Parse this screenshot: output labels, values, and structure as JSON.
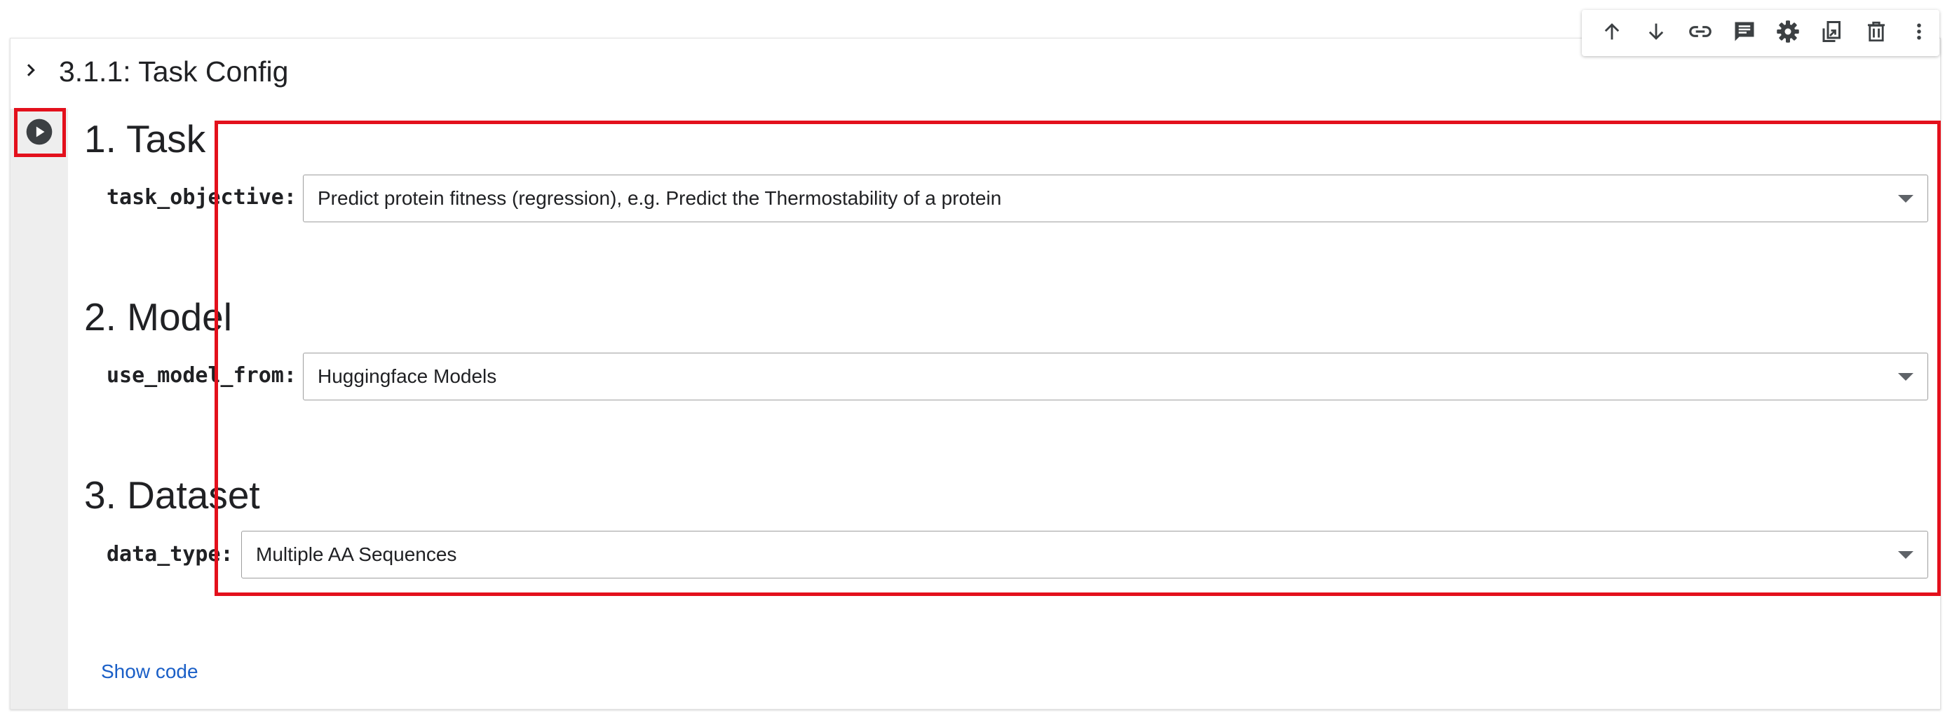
{
  "toolbar": {
    "buttons": [
      {
        "name": "move-cell-up-icon",
        "label": "Move cell up"
      },
      {
        "name": "move-cell-down-icon",
        "label": "Move cell down"
      },
      {
        "name": "link-icon",
        "label": "Copy link to cell"
      },
      {
        "name": "comment-icon",
        "label": "Add comment"
      },
      {
        "name": "gear-icon",
        "label": "Open editor settings"
      },
      {
        "name": "mirror-cell-icon",
        "label": "Mirror cell in tab"
      },
      {
        "name": "trash-icon",
        "label": "Delete cell"
      },
      {
        "name": "more-vert-icon",
        "label": "More cell actions"
      }
    ]
  },
  "section": {
    "title": "3.1.1: Task Config"
  },
  "form": {
    "task": {
      "heading": "1. Task",
      "param_label": "task_objective:",
      "value": "Predict protein fitness (regression), e.g. Predict the Thermostability of a protein"
    },
    "model": {
      "heading": "2. Model",
      "param_label": "use_model_from:",
      "value": "Huggingface Models"
    },
    "dataset": {
      "heading": "3. Dataset",
      "param_label": "data_type:",
      "value": "Multiple AA Sequences"
    },
    "show_code_label": "Show code"
  },
  "colors": {
    "annotation": "#e3101c",
    "link": "#1a5fc7",
    "gutter": "#eeeeee",
    "icon": "#5f6368"
  }
}
